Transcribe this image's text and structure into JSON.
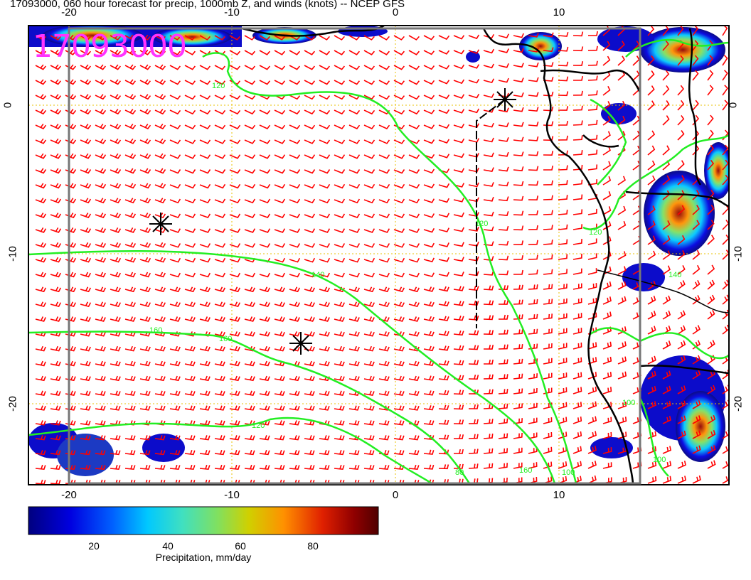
{
  "title": "17093000, 060 hour forecast for precip, 1000mb Z, and winds (knots) -- NCEP GFS",
  "stamp": "17093000",
  "axes": {
    "lon_ticks": [
      "-20",
      "-10",
      "0",
      "10"
    ],
    "lat_ticks": [
      "0",
      "-10",
      "-20"
    ],
    "lon_range": [
      -22.5,
      20.5
    ],
    "lat_range": [
      -25.5,
      5.5
    ]
  },
  "contour_labels": [
    "120",
    "120",
    "140",
    "160",
    "160",
    "120",
    "80",
    "160",
    "100",
    "120",
    "100",
    "140",
    "100"
  ],
  "colorbar": {
    "ticks": [
      "20",
      "40",
      "60",
      "80"
    ],
    "label": "Precipitation, mm/day",
    "colors": [
      "#00007f",
      "#0000e0",
      "#0060ff",
      "#00c8ff",
      "#40e0c0",
      "#80e060",
      "#d0d000",
      "#ff9000",
      "#e02000",
      "#900000",
      "#500000"
    ]
  },
  "colors": {
    "wind_barbs": "#ff0000",
    "contours": "#22ee22",
    "coast": "#000000",
    "grid": "#e8c000",
    "stamp": "#ff33ff"
  },
  "icons": [
    "storm-marker-icon",
    "storm-marker-icon",
    "storm-marker-icon"
  ]
}
